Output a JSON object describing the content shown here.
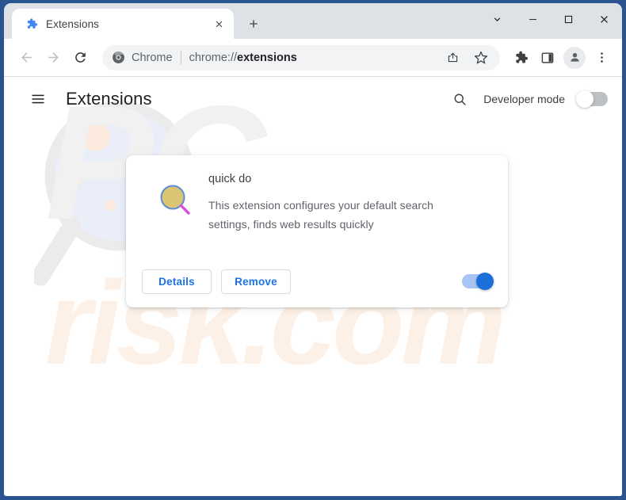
{
  "window": {
    "controls": [
      {
        "name": "tab-search",
        "icon": "chevron-down-icon",
        "label": "Search tabs"
      },
      {
        "name": "minimize",
        "icon": "minimize-icon",
        "label": "Minimize"
      },
      {
        "name": "maximize",
        "icon": "maximize-icon",
        "label": "Maximize"
      },
      {
        "name": "close",
        "icon": "close-icon",
        "label": "Close"
      }
    ]
  },
  "tabstrip": {
    "tabs": [
      {
        "title": "Extensions",
        "favicon": "puzzle-piece-icon",
        "close_label": "Close tab",
        "active": true
      }
    ],
    "new_tab_label": "New Tab"
  },
  "toolbar": {
    "back_label": "Back",
    "forward_label": "Forward",
    "reload_label": "Reload",
    "omnibox": {
      "chip_icon": "chrome-logo-icon",
      "chip_label": "Chrome",
      "url_scheme": "chrome://",
      "url_path": "extensions",
      "share_label": "Share this page",
      "bookmark_label": "Bookmark this tab"
    },
    "extensions_label": "Extensions",
    "side_panel_label": "Side panel",
    "profile_label": "Profile",
    "menu_label": "Customize and control Google Chrome"
  },
  "page_header": {
    "menu_label": "Main menu",
    "title": "Extensions",
    "search_label": "Search extensions",
    "developer_mode_label": "Developer mode",
    "developer_mode_on": false
  },
  "watermark": {
    "text_top": "PC",
    "text_bottom": "risk.com"
  },
  "extension_card": {
    "icon_name": "magnifying-glass-icon",
    "name": "quick do",
    "description": "This extension configures your default search settings, finds web results quickly",
    "details_label": "Details",
    "remove_label": "Remove",
    "enabled": true,
    "enable_toggle_label": "Enable quick do"
  },
  "colors": {
    "accent_blue": "#1a73e8",
    "toggle_on_track": "#a7c4f2",
    "toggle_on_knob": "#1a6fdb",
    "toggle_off_track": "#bdc1c6",
    "window_frame": "#2a5490",
    "tabstrip_bg": "#dee1e6",
    "omnibox_bg": "#f1f3f4",
    "text_primary": "#202124",
    "text_secondary": "#5f6368",
    "icon_lens": "#dbc473",
    "icon_ring": "#5b8fd4",
    "icon_handle": "#d94fd9",
    "watermark_gray": "#f1f1f1",
    "watermark_peach": "#fdf0e6"
  }
}
